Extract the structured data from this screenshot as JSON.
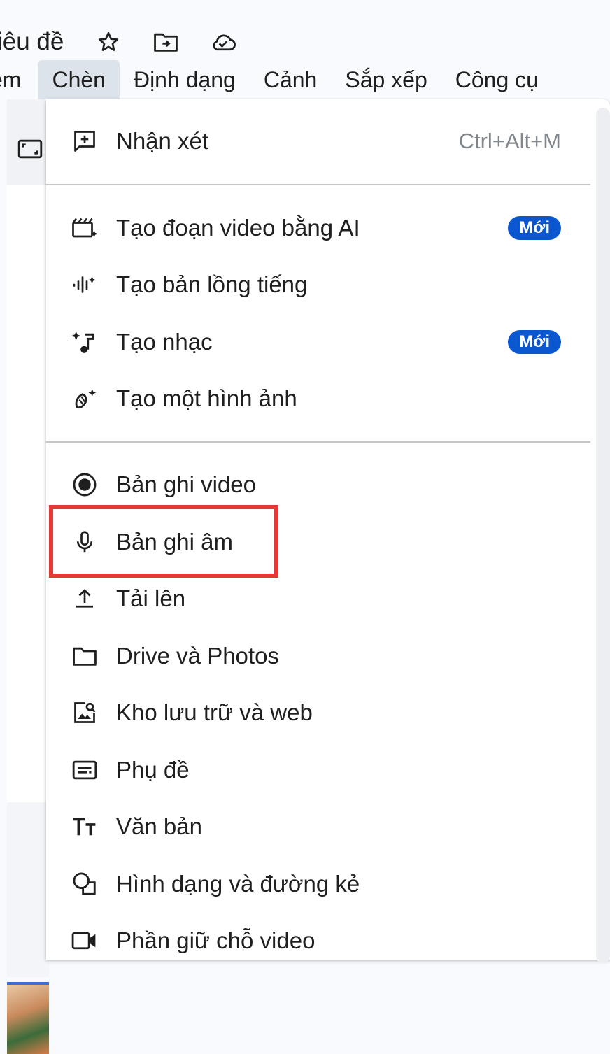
{
  "header": {
    "title": "iêu đề",
    "icons": [
      "star-icon",
      "move-to-folder-icon",
      "cloud-saved-icon"
    ]
  },
  "menubar": {
    "items": [
      {
        "label": "em"
      },
      {
        "label": "Chèn"
      },
      {
        "label": "Định dạng"
      },
      {
        "label": "Cảnh"
      },
      {
        "label": "Sắp xếp"
      },
      {
        "label": "Công cụ"
      }
    ],
    "active": "Chèn"
  },
  "insert_menu": {
    "items": [
      {
        "label": "Nhận xét",
        "shortcut": "Ctrl+Alt+M",
        "icon": "add-comment-icon"
      },
      {
        "label": "Tạo đoạn video bằng AI",
        "badge": "Mới",
        "icon": "ai-video-icon"
      },
      {
        "label": "Tạo bản lồng tiếng",
        "icon": "ai-voiceover-icon"
      },
      {
        "label": "Tạo nhạc",
        "badge": "Mới",
        "icon": "ai-music-icon"
      },
      {
        "label": "Tạo một hình ảnh",
        "icon": "ai-image-icon"
      },
      {
        "label": "Bản ghi video",
        "icon": "record-icon"
      },
      {
        "label": "Bản ghi âm",
        "icon": "mic-icon",
        "highlighted": true
      },
      {
        "label": "Tải lên",
        "icon": "upload-icon"
      },
      {
        "label": "Drive và Photos",
        "icon": "folder-icon"
      },
      {
        "label": "Kho lưu trữ và web",
        "icon": "image-search-icon"
      },
      {
        "label": "Phụ đề",
        "icon": "subtitles-icon"
      },
      {
        "label": "Văn bản",
        "icon": "text-icon"
      },
      {
        "label": "Hình dạng và đường kẻ",
        "icon": "shapes-icon"
      },
      {
        "label": "Phần giữ chỗ video",
        "icon": "video-placeholder-icon"
      }
    ]
  },
  "colors": {
    "accent": "#0b57d0",
    "highlight_border": "#e53935",
    "menubar_active": "#dde3ea"
  }
}
